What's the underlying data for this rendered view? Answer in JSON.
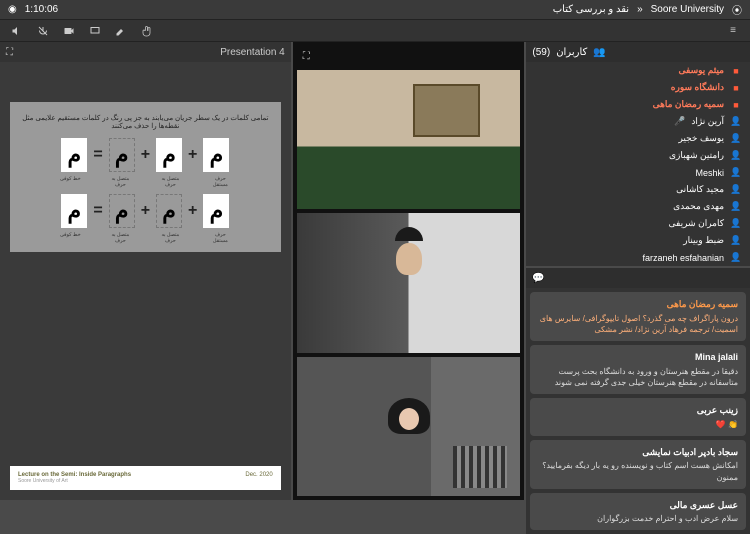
{
  "header": {
    "timer": "1:10:06",
    "university": "Soore University",
    "session": "نقد و بررسی کتاب"
  },
  "presentation": {
    "title": "Presentation 4",
    "slide": {
      "caption_ar": "تمامی کلمات در یک سطر جریان می‌یابند به جز پی رنگ در کلمات مستقیم علایمی مثل نقطه‌ها را حذف می‌کنند",
      "row1": [
        "م",
        "م",
        "م",
        "م"
      ],
      "row2": [
        "م",
        "م",
        "م",
        "م"
      ],
      "sublabels": [
        "خط کوفی",
        "متصل به حرف",
        "متصل به حرف",
        "حرف مستقل"
      ],
      "footer_title": "Lecture on the Semi: Inside Paragraphs",
      "footer_sub": "Soore University of Art",
      "footer_date": "Dec. 2020"
    }
  },
  "users": {
    "title": "کاربران",
    "count": "(59)",
    "list": [
      {
        "name": "میثم یوسفی",
        "role": "mod",
        "mic": false
      },
      {
        "name": "دانشگاه سوره",
        "role": "mod",
        "mic": false
      },
      {
        "name": "سمیه رمضان ماهی",
        "role": "mod",
        "mic": false
      },
      {
        "name": "آرین نژاد",
        "role": "user",
        "mic": true
      },
      {
        "name": "یوسف خجیر",
        "role": "user",
        "mic": false
      },
      {
        "name": "رامتین شهبازی",
        "role": "user",
        "mic": false
      },
      {
        "name": "Meshki",
        "role": "user",
        "mic": false
      },
      {
        "name": "مجید کاشانی",
        "role": "user",
        "mic": false
      },
      {
        "name": "مهدی محمدی",
        "role": "user",
        "mic": false
      },
      {
        "name": "کامران شریفی",
        "role": "user",
        "mic": false
      },
      {
        "name": "ضبط وبینار",
        "role": "user",
        "mic": false
      },
      {
        "name": "farzaneh esfahanian",
        "role": "user",
        "mic": false
      }
    ]
  },
  "chat": {
    "messages": [
      {
        "name": "سمیه رمضان ماهی",
        "style": "orange",
        "body": "درون پاراگراف چه می گذرد؟ اصول تایپوگرافی/ سایرس های اسمیت/ ترجمه فرهاد آرین نژاد/ نشر مشکی"
      },
      {
        "name": "Mina jalali",
        "style": "white",
        "body": "دقیقا در مقطع هنرستان و ورود به دانشگاه بحث پرست متاسفانه در مقطع هنرستان خیلی جدی گرفته نمی شوند"
      },
      {
        "name": "زینب عربی",
        "style": "white",
        "body": "👏 ❤️"
      },
      {
        "name": "سجاد بادپر ادبیات نمایشی",
        "style": "white",
        "body": "امکانش هست اسم کتاب و نویسنده رو یه بار دیگه بفرمایید؟ممنون"
      },
      {
        "name": "عسل عسری مالی",
        "style": "white",
        "body": "سلام عرض ادب و احترام خدمت بزرگواران"
      }
    ]
  }
}
